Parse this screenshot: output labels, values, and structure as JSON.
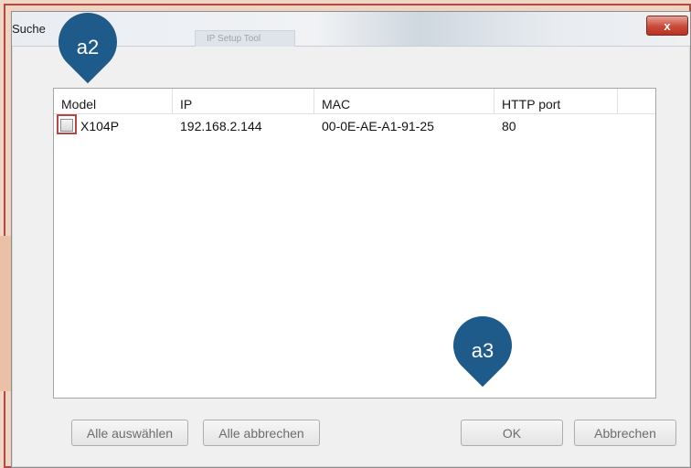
{
  "window": {
    "title": "Suche",
    "ghost_tab": "IP Setup Tool",
    "close_glyph": "x"
  },
  "listview": {
    "columns": [
      "Model",
      "IP",
      "MAC",
      "HTTP port"
    ],
    "rows": [
      {
        "model": "X104P",
        "ip": "192.168.2.144",
        "mac": "00-0E-AE-A1-91-25",
        "http_port": "80",
        "checked": false
      }
    ]
  },
  "buttons": {
    "select_all": "Alle auswählen",
    "cancel_all": "Alle abbrechen",
    "ok": "OK",
    "cancel": "Abbrechen"
  },
  "annotations": {
    "pin_a2": "a2",
    "pin_a3": "a3"
  },
  "colors": {
    "pin": "#1e5a8a",
    "highlight": "#b04848",
    "backdrop": "#f2d6c4"
  }
}
